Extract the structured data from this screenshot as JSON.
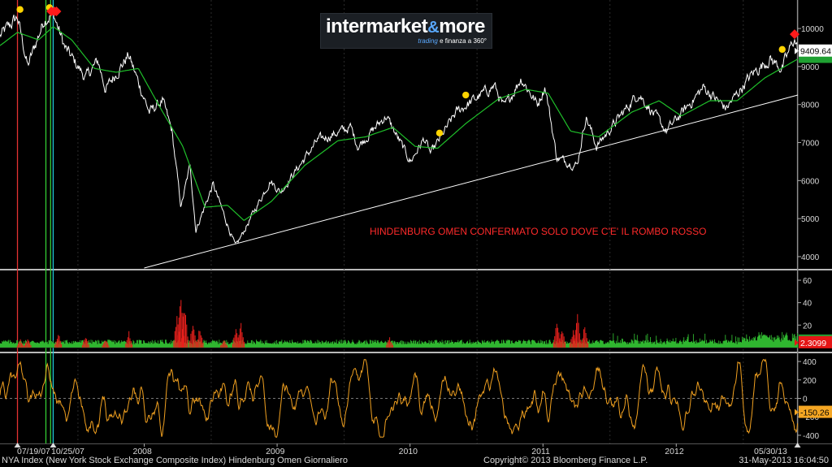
{
  "logo": {
    "main": "intermarket",
    "amp": "&",
    "more": "more",
    "sub_trading": "trading",
    "sub_rest": "e finanza a 360°"
  },
  "footer": {
    "left": "NYA Index (New York Stock Exchange Composite Index) Hindenburg Omen  Giornaliero",
    "copyright": "Copyright© 2013 Bloomberg Finance L.P.",
    "timestamp": "31-May-2013 16:04:50"
  },
  "annotation": "HINDENBURG OMEN CONFERMATO SOLO DOVE C'E' IL ROMBO ROSSO",
  "colors": {
    "price": "#ffffff",
    "ma": "#1fbf2a",
    "trendline": "#ffffff",
    "signal_dot": "#ffd400",
    "diamond": "#ff1a1a",
    "histo_green": "#2fb62f",
    "histo_red": "#e8201c",
    "oscillator": "#f0a020",
    "separator": "#b8b8b8"
  },
  "chart_data": [
    {
      "type": "line",
      "panel": "price",
      "title": "NYA Index (New York Stock Exchange Composite Index)",
      "xlabel": "",
      "ylabel": "",
      "x_start": "2007-06-01",
      "x_end": "2013-05-31",
      "x_ticks": [
        "07/19/07",
        "10/25/07",
        "2008",
        "2009",
        "2010",
        "2011",
        "2012",
        "05/30/13"
      ],
      "x_tick_dates": [
        "2007-07-19",
        "2007-10-25",
        "2008-07-01",
        "2009-07-01",
        "2010-07-01",
        "2011-07-01",
        "2012-07-01",
        "2013-05-30"
      ],
      "y_ticks": [
        4000,
        5000,
        6000,
        7000,
        8000,
        9000,
        10000
      ],
      "ylim": [
        3700,
        10750
      ],
      "last_value": "9409.64",
      "series": [
        {
          "role": "price",
          "points": [
            [
              "2007-06-01",
              9800
            ],
            [
              "2007-07-19",
              10300
            ],
            [
              "2007-08-16",
              9000
            ],
            [
              "2007-10-01",
              10250
            ],
            [
              "2007-10-25",
              10400
            ],
            [
              "2007-11-26",
              9500
            ],
            [
              "2008-01-22",
              8700
            ],
            [
              "2008-02-25",
              9150
            ],
            [
              "2008-03-17",
              8400
            ],
            [
              "2008-05-19",
              9300
            ],
            [
              "2008-07-15",
              7800
            ],
            [
              "2008-08-20",
              8100
            ],
            [
              "2008-09-15",
              7300
            ],
            [
              "2008-10-10",
              5300
            ],
            [
              "2008-11-04",
              6400
            ],
            [
              "2008-11-20",
              4700
            ],
            [
              "2009-01-06",
              5900
            ],
            [
              "2009-03-09",
              4250
            ],
            [
              "2009-06-12",
              6000
            ],
            [
              "2009-07-10",
              5700
            ],
            [
              "2009-10-20",
              7050
            ],
            [
              "2010-01-19",
              7400
            ],
            [
              "2010-02-08",
              6900
            ],
            [
              "2010-04-26",
              7700
            ],
            [
              "2010-07-02",
              6500
            ],
            [
              "2010-08-09",
              7100
            ],
            [
              "2010-08-27",
              6700
            ],
            [
              "2010-11-05",
              7800
            ],
            [
              "2011-02-18",
              8500
            ],
            [
              "2011-03-16",
              7900
            ],
            [
              "2011-05-02",
              8700
            ],
            [
              "2011-06-16",
              8000
            ],
            [
              "2011-07-07",
              8500
            ],
            [
              "2011-08-08",
              6600
            ],
            [
              "2011-10-03",
              6400
            ],
            [
              "2011-10-27",
              7700
            ],
            [
              "2011-11-25",
              6900
            ],
            [
              "2012-03-19",
              8300
            ],
            [
              "2012-06-04",
              7300
            ],
            [
              "2012-09-14",
              8450
            ],
            [
              "2012-11-15",
              7900
            ],
            [
              "2013-01-25",
              8800
            ],
            [
              "2013-03-15",
              9200
            ],
            [
              "2013-04-18",
              8950
            ],
            [
              "2013-05-21",
              9750
            ],
            [
              "2013-05-31",
              9409.64
            ]
          ]
        },
        {
          "role": "moving_average",
          "points": [
            [
              "2007-06-01",
              9550
            ],
            [
              "2007-07-19",
              9900
            ],
            [
              "2007-09-15",
              9700
            ],
            [
              "2007-10-25",
              10050
            ],
            [
              "2007-12-15",
              9700
            ],
            [
              "2008-02-15",
              8950
            ],
            [
              "2008-04-15",
              8850
            ],
            [
              "2008-06-15",
              8950
            ],
            [
              "2008-08-15",
              7900
            ],
            [
              "2008-10-15",
              6900
            ],
            [
              "2008-12-15",
              5300
            ],
            [
              "2009-02-15",
              5350
            ],
            [
              "2009-04-01",
              4950
            ],
            [
              "2009-06-15",
              5450
            ],
            [
              "2009-09-15",
              6400
            ],
            [
              "2009-12-15",
              7050
            ],
            [
              "2010-03-01",
              7150
            ],
            [
              "2010-05-15",
              7400
            ],
            [
              "2010-07-15",
              6900
            ],
            [
              "2010-09-15",
              6850
            ],
            [
              "2010-12-01",
              7500
            ],
            [
              "2011-03-01",
              8150
            ],
            [
              "2011-05-15",
              8400
            ],
            [
              "2011-07-15",
              8300
            ],
            [
              "2011-09-15",
              7300
            ],
            [
              "2011-12-01",
              7150
            ],
            [
              "2012-03-01",
              7800
            ],
            [
              "2012-05-15",
              8100
            ],
            [
              "2012-07-15",
              7700
            ],
            [
              "2012-10-01",
              8100
            ],
            [
              "2012-12-15",
              8100
            ],
            [
              "2013-03-01",
              8700
            ],
            [
              "2013-05-31",
              9200
            ]
          ]
        },
        {
          "role": "trendline",
          "points": [
            [
              "2008-07-01",
              3700
            ],
            [
              "2013-05-31",
              8250
            ]
          ]
        }
      ],
      "signals": [
        {
          "date": "2007-07-26",
          "y": 10500,
          "kind": "dot"
        },
        {
          "date": "2007-10-15",
          "y": 10550,
          "kind": "dot"
        },
        {
          "date": "2007-10-20",
          "y": 10450,
          "kind": "diamond"
        },
        {
          "date": "2007-10-28",
          "y": 10450,
          "kind": "diamond"
        },
        {
          "date": "2007-11-03",
          "y": 10450,
          "kind": "diamond"
        },
        {
          "date": "2010-09-20",
          "y": 7250,
          "kind": "dot"
        },
        {
          "date": "2010-12-01",
          "y": 8250,
          "kind": "dot"
        },
        {
          "date": "2013-04-18",
          "y": 9450,
          "kind": "dot"
        },
        {
          "date": "2013-05-22",
          "y": 9850,
          "kind": "diamond"
        }
      ],
      "vertical_markers": [
        {
          "date": "2007-07-19",
          "color": "#e23232"
        },
        {
          "date": "2007-10-05",
          "color": "#33cc33"
        },
        {
          "date": "2007-10-18",
          "color": "#33cc33"
        },
        {
          "date": "2007-10-25",
          "color": "#20c8d8"
        },
        {
          "date": "2013-05-30",
          "color": "#bcbcbc"
        }
      ]
    },
    {
      "type": "bar",
      "panel": "histogram",
      "y_ticks": [
        20,
        40,
        60
      ],
      "ylim": [
        -3,
        68
      ],
      "last_value": "2.3099",
      "spikes": [
        {
          "date": "2007-07-27",
          "value": 8,
          "color": "red"
        },
        {
          "date": "2007-08-16",
          "value": 10,
          "color": "red"
        },
        {
          "date": "2007-11-08",
          "value": 14,
          "color": "red"
        },
        {
          "date": "2008-01-22",
          "value": 12,
          "color": "red"
        },
        {
          "date": "2008-03-17",
          "value": 8,
          "color": "red"
        },
        {
          "date": "2008-05-20",
          "value": 15,
          "color": "red"
        },
        {
          "date": "2008-09-29",
          "value": 30,
          "color": "red"
        },
        {
          "date": "2008-10-10",
          "value": 58,
          "color": "red"
        },
        {
          "date": "2008-10-20",
          "value": 42,
          "color": "red"
        },
        {
          "date": "2008-11-12",
          "value": 25,
          "color": "red"
        },
        {
          "date": "2008-12-01",
          "value": 20,
          "color": "red"
        },
        {
          "date": "2009-02-05",
          "value": 8,
          "color": "red"
        },
        {
          "date": "2009-03-10",
          "value": 18,
          "color": "red"
        },
        {
          "date": "2009-03-24",
          "value": 24,
          "color": "red"
        },
        {
          "date": "2010-05-06",
          "value": 10,
          "color": "red"
        },
        {
          "date": "2011-08-08",
          "value": 28,
          "color": "red"
        },
        {
          "date": "2011-08-22",
          "value": 20,
          "color": "red"
        },
        {
          "date": "2011-09-22",
          "value": 18,
          "color": "red"
        },
        {
          "date": "2011-10-04",
          "value": 35,
          "color": "red"
        },
        {
          "date": "2011-10-24",
          "value": 22,
          "color": "red"
        },
        {
          "date": "2013-05-22",
          "value": 12,
          "color": "green"
        }
      ]
    },
    {
      "type": "line",
      "panel": "oscillator",
      "y_ticks": [
        -400,
        -200,
        0,
        200,
        400
      ],
      "ylim": [
        -480,
        480
      ],
      "last_value": "-150.26"
    }
  ]
}
